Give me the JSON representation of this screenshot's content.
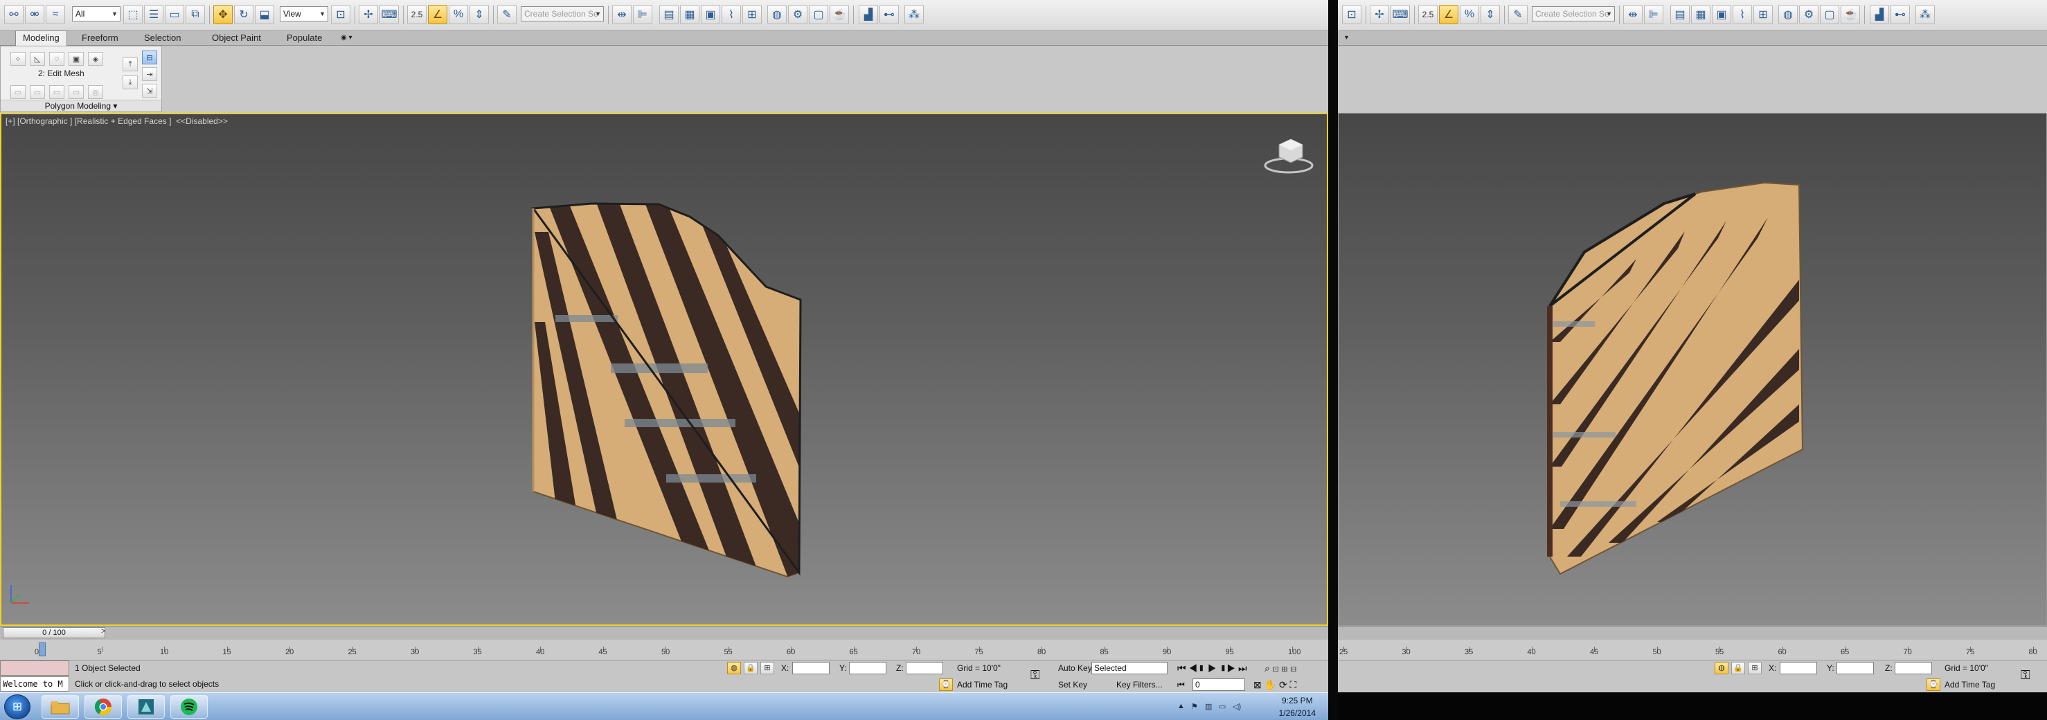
{
  "toolbar": {
    "selection_filter": "All",
    "reference_coord": "View",
    "snap_label": "2.5",
    "named_selection_placeholder": "Create Selection Se"
  },
  "ribbon": {
    "tabs": [
      "Modeling",
      "Freeform",
      "Selection",
      "Object Paint",
      "Populate"
    ],
    "active_tab": "Modeling",
    "modifier": "2: Edit Mesh",
    "panel_title": "Polygon Modeling"
  },
  "viewport_left": {
    "label": "[+] [Orthographic ] [Realistic + Edged Faces ]  <<Disabled>>"
  },
  "timeline": {
    "frame_counter": "0 / 100",
    "next_button": ">",
    "ticks_left": [
      "0",
      "5",
      "10",
      "15",
      "20",
      "25",
      "30",
      "35",
      "40",
      "45",
      "50",
      "55",
      "60",
      "65",
      "70",
      "75",
      "80",
      "85",
      "90",
      "95",
      "100"
    ],
    "ticks_right": [
      "25",
      "30",
      "35",
      "40",
      "45",
      "50",
      "55",
      "60",
      "65",
      "70",
      "75",
      "80"
    ]
  },
  "status": {
    "selected": "1 Object Selected",
    "prompt": "Click or click-and-drag to select objects",
    "x_label": "X:",
    "y_label": "Y:",
    "z_label": "Z:",
    "grid": "Grid = 10'0\"",
    "add_time_tag": "Add Time Tag",
    "auto_key": "Auto Key",
    "set_key": "Set Key",
    "key_mode": "Selected",
    "key_filters": "Key Filters...",
    "frame_value": "0",
    "maxscript": "Welcome to M"
  },
  "taskbar": {
    "time": "9:25 PM",
    "date": "1/26/2014"
  },
  "colors": {
    "viewport_border": "#f4d21e",
    "wood": "#d8b07c",
    "active_tool": "#f5c542"
  }
}
